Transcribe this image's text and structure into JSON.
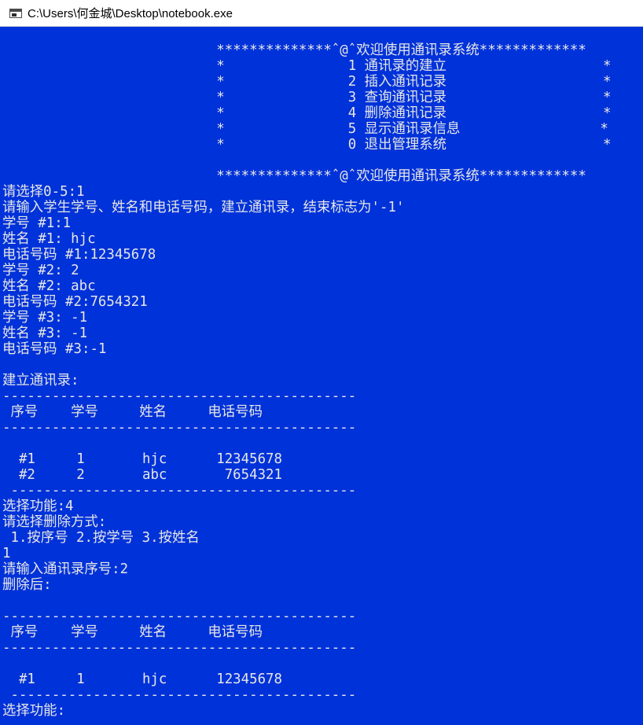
{
  "window": {
    "title": "C:\\Users\\何金城\\Desktop\\notebook.exe",
    "console_bg": "#0032d9",
    "console_fg": "#e6e6e6"
  },
  "console": {
    "lines": [
      "                          **************ˆ@ˆ欢迎使用通讯录系统*************",
      "                          *               1 通讯录的建立                   *",
      "                          *               2 插入通讯记录                   *",
      "                          *               3 查询通讯记录                   *",
      "                          *               4 删除通讯记录                   *",
      "                          *               5 显示通讯录信息                 *",
      "                          *               0 退出管理系统                   *",
      "",
      "                          **************ˆ@ˆ欢迎使用通讯录系统*************",
      "请选择0-5:1",
      "请输入学生学号、姓名和电话号码，建立通讯录，结束标志为'-1'",
      "学号 #1:1",
      "姓名 #1: hjc",
      "电话号码 #1:12345678",
      "学号 #2: 2",
      "姓名 #2: abc",
      "电话号码 #2:7654321",
      "学号 #3: -1",
      "姓名 #3: -1",
      "电话号码 #3:-1",
      "",
      "建立通讯录:",
      "-------------------------------------------",
      " 序号    学号     姓名     电话号码",
      "-------------------------------------------",
      "",
      "  #1     1       hjc      12345678",
      "  #2     2       abc       7654321",
      " ------------------------------------------",
      "选择功能:4",
      "请选择删除方式:",
      " 1.按序号 2.按学号 3.按姓名",
      "1",
      "请输入通讯录序号:2",
      "删除后:",
      "",
      "-------------------------------------------",
      " 序号    学号     姓名     电话号码",
      "-------------------------------------------",
      "",
      "  #1     1       hjc      12345678",
      " ------------------------------------------",
      "选择功能:"
    ]
  }
}
